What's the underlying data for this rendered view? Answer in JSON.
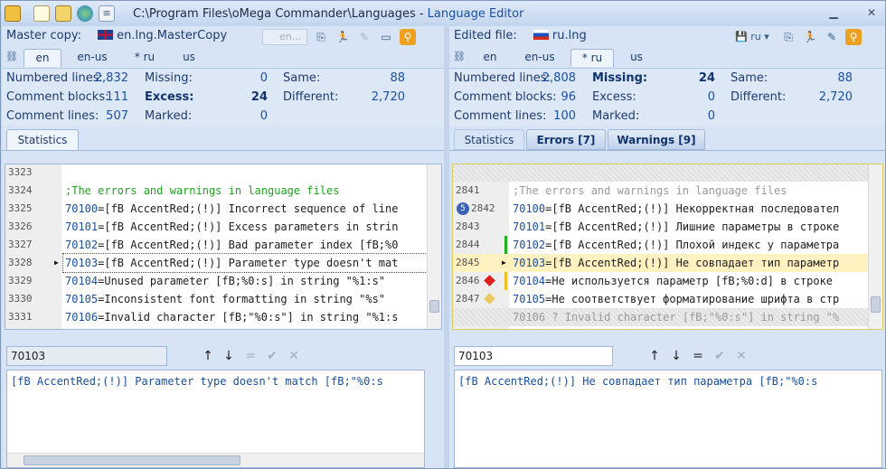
{
  "app": {
    "title_path": "C:\\Program Files\\oMega Commander\\Languages - ",
    "title_name": "Language Editor"
  },
  "icons": [
    "app-icon",
    "new-icon",
    "open-icon",
    "globe-icon",
    "menu-icon",
    "minimize-icon",
    "close-icon"
  ],
  "left": {
    "header_label": "Master copy:",
    "file": "en.lng.MasterCopy",
    "toolbar_combo": "en...",
    "tabs": [
      "en",
      "en-us",
      "* ru",
      "us"
    ],
    "stats": {
      "numbered_lines_label": "Numbered lines:",
      "numbered_lines": "2,832",
      "comment_blocks_label": "Comment blocks:",
      "comment_blocks": "111",
      "comment_lines_label": "Comment lines:",
      "comment_lines": "507",
      "missing_label": "Missing:",
      "missing": "0",
      "excess_label": "Excess:",
      "excess": "24",
      "marked_label": "Marked:",
      "marked": "0",
      "same_label": "Same:",
      "same": "88",
      "different_label": "Different:",
      "different": "2,720"
    },
    "stat_tabs": [
      "Statistics"
    ],
    "lines": [
      {
        "n": "3323",
        "code": ""
      },
      {
        "n": "3324",
        "code": ";The errors and warnings in language files"
      },
      {
        "n": "3325",
        "id": "70100",
        "code": "[fB AccentRed;(!)] Incorrect sequence of line"
      },
      {
        "n": "3326",
        "id": "70101",
        "code": "[fB AccentRed;(!)] Excess parameters in strin"
      },
      {
        "n": "3327",
        "id": "70102",
        "code": "[fB AccentRed;(!)] Bad parameter index [fB;%0"
      },
      {
        "n": "3328",
        "id": "70103",
        "code": "[fB AccentRed;(!)] Parameter type doesn't mat"
      },
      {
        "n": "3329",
        "id": "70104",
        "code": "Unused parameter [fB;%0:s] in string \"%1:s\""
      },
      {
        "n": "3330",
        "id": "70105",
        "code": "Inconsistent font formatting in string \"%s\""
      },
      {
        "n": "3331",
        "id": "70106",
        "code": "Invalid character [fB;\"%0:s\"] in string \"%1:s"
      }
    ],
    "find_value": "70103",
    "preview": "[fB AccentRed;(!)] Parameter type doesn't match [fB;\"%0:s"
  },
  "right": {
    "header_label": "Edited file:",
    "file": "ru.lng",
    "toolbar_combo": "ru",
    "tabs": [
      "en",
      "en-us",
      "* ru",
      "us"
    ],
    "stats": {
      "numbered_lines_label": "Numbered lines:",
      "numbered_lines": "2,808",
      "comment_blocks_label": "Comment blocks:",
      "comment_blocks": "96",
      "comment_lines_label": "Comment lines:",
      "comment_lines": "100",
      "missing_label": "Missing:",
      "missing": "24",
      "excess_label": "Excess:",
      "excess": "0",
      "marked_label": "Marked:",
      "marked": "0",
      "same_label": "Same:",
      "same": "88",
      "different_label": "Different:",
      "different": "2,720"
    },
    "stat_tabs": [
      "Statistics",
      "Errors [7]",
      "Warnings [9]"
    ],
    "lines": [
      {
        "n": "",
        "code": ""
      },
      {
        "n": "2841",
        "code": ";The errors and warnings in language files"
      },
      {
        "n": "2842",
        "id": "70100",
        "code": "[fB AccentRed;(!)] Некорректная последовател"
      },
      {
        "n": "2843",
        "id": "70101",
        "code": "[fB AccentRed;(!)] Лишние параметры в строке"
      },
      {
        "n": "2844",
        "id": "70102",
        "code": "[fB AccentRed;(!)] Плохой индекс у параметра"
      },
      {
        "n": "2845",
        "id": "70103",
        "code": "[fB AccentRed;(!)] Не совпадает тип параметр"
      },
      {
        "n": "2846",
        "id": "70104",
        "code": "Не используется параметр [fB;%0:d] в строке"
      },
      {
        "n": "2847",
        "id": "70105",
        "code": "Не соответствует форматирование шрифта в стр"
      },
      {
        "n": "",
        "code": "70106 ? Invalid character [fB;\"%0:s\"] in string \"%"
      }
    ],
    "badge": "5",
    "find_value": "70103",
    "preview": "[fB AccentRed;(!)] Не совпадает тип параметра [fB;\"%0:s"
  },
  "find_buttons": {
    "up": "↑",
    "down": "↓",
    "eq": "=",
    "ok": "✔",
    "cancel": "✕"
  },
  "colors": {
    "accent": "#1b4fa3",
    "comment": "#1fa31f",
    "highlight": "#fff2c0",
    "error": "#e02020",
    "warning": "#e8c860"
  }
}
